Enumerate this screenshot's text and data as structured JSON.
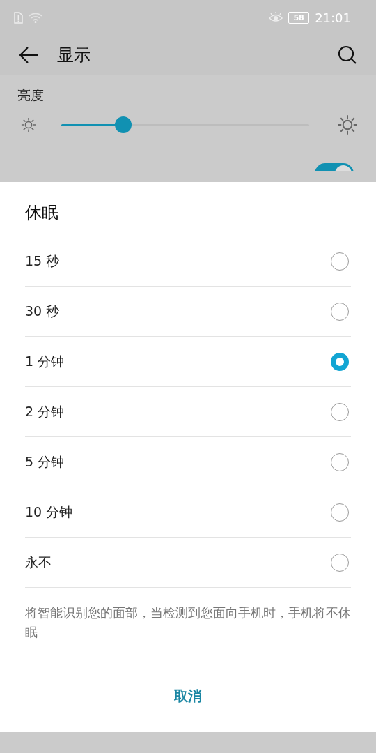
{
  "status_bar": {
    "time": "21:01",
    "battery": "58"
  },
  "header": {
    "title": "显示"
  },
  "brightness": {
    "label": "亮度",
    "level": 0.25
  },
  "auto_adjust": {
    "on": true
  },
  "dialog": {
    "title": "休眠",
    "options": [
      {
        "label": "15 秒",
        "selected": false
      },
      {
        "label": "30 秒",
        "selected": false
      },
      {
        "label": "1 分钟",
        "selected": true
      },
      {
        "label": "2 分钟",
        "selected": false
      },
      {
        "label": "5 分钟",
        "selected": false
      },
      {
        "label": "10 分钟",
        "selected": false
      },
      {
        "label": "永不",
        "selected": false
      }
    ],
    "note": "将智能识别您的面部，当检测到您面向手机时，手机将不休眠",
    "cancel": "取消"
  }
}
